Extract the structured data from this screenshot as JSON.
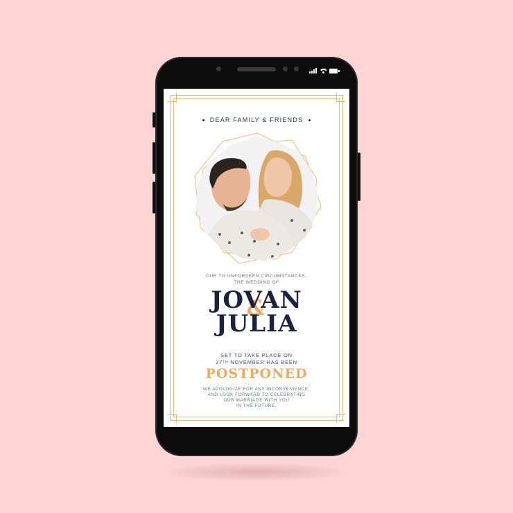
{
  "colors": {
    "background": "#fdd5d5",
    "phone": "#0d0d0d",
    "accent_gold": "#f3aa5c",
    "navy": "#1a2242"
  },
  "invitation": {
    "greeting": "DEAR FAMILY & FRIENDS",
    "intro_line1": "DUE TO UNFORSEEN CIRCUMSTANCES,",
    "intro_line2": "THE WEDDING OF",
    "name1": "JOVAN",
    "ampersand": "&",
    "name2": "JULIA",
    "detail_line1": "SET TO TAKE PLACE ON",
    "detail_day": "27",
    "detail_day_suffix": "TH",
    "detail_line2_rest": " NOVEMBER HAS BEEN",
    "status": "POSTPONED",
    "apology_line1": "WE APOLOGIZE FOR ANY INCONVENIENCE,",
    "apology_line2": "AND LOOK FORWARD TO CELEBRATING",
    "apology_line3": "OUR MARRIAGE WITH YOU",
    "apology_line4": "IN THE FUTURE."
  },
  "icons": {
    "signal": "signal-icon",
    "wifi": "wifi-icon",
    "battery": "battery-icon"
  }
}
